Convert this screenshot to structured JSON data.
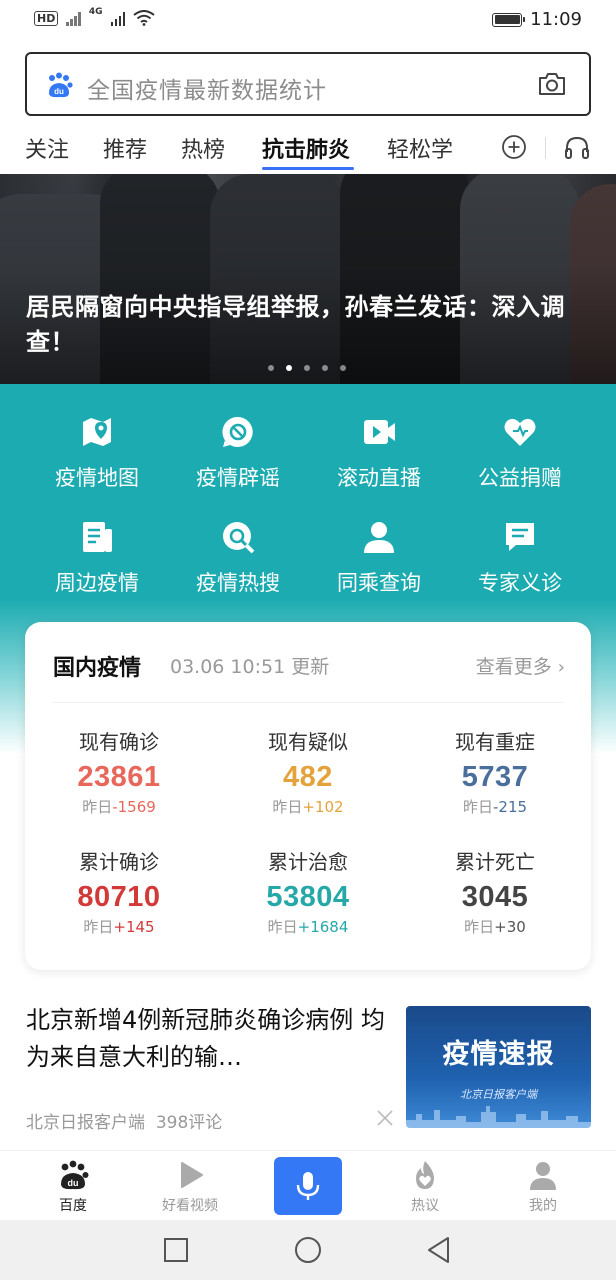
{
  "status_bar": {
    "left_badge": "HD",
    "network_label": "4G",
    "time": "11:09"
  },
  "search": {
    "placeholder": "全国疫情最新数据统计",
    "logo_icon": "baidu-paw-icon",
    "camera_icon": "camera-icon"
  },
  "tabs": [
    {
      "label": "关注",
      "active": false
    },
    {
      "label": "推荐",
      "active": false
    },
    {
      "label": "热榜",
      "active": false
    },
    {
      "label": "抗击肺炎",
      "active": true
    },
    {
      "label": "轻松学",
      "active": false
    }
  ],
  "banner": {
    "title": "居民隔窗向中央指导组举报，孙春兰发话：深入调查！",
    "dot_count": 5,
    "active_dot": 2
  },
  "feature_grid": [
    {
      "label": "疫情地图",
      "icon": "map-pin-icon"
    },
    {
      "label": "疫情辟谣",
      "icon": "block-icon"
    },
    {
      "label": "滚动直播",
      "icon": "video-icon"
    },
    {
      "label": "公益捐赠",
      "icon": "heart-icon"
    },
    {
      "label": "周边疫情",
      "icon": "document-icon"
    },
    {
      "label": "疫情热搜",
      "icon": "search-icon"
    },
    {
      "label": "同乘查询",
      "icon": "person-icon"
    },
    {
      "label": "专家义诊",
      "icon": "chat-icon"
    }
  ],
  "stats_card": {
    "title": "国内疫情",
    "updated": "03.06 10:51 更新",
    "more": "查看更多",
    "delta_prefix": "昨日",
    "stats": [
      {
        "label": "现有确诊",
        "value": "23861",
        "delta": "-1569",
        "color": "#e8665a",
        "delta_color": "#e8665a"
      },
      {
        "label": "现有疑似",
        "value": "482",
        "delta": "+102",
        "color": "#e3a33a",
        "delta_color": "#e3a33a"
      },
      {
        "label": "现有重症",
        "value": "5737",
        "delta": "-215",
        "color": "#4a6f9c",
        "delta_color": "#4a6f9c"
      },
      {
        "label": "累计确诊",
        "value": "80710",
        "delta": "+145",
        "color": "#d23a3a",
        "delta_color": "#d23a3a"
      },
      {
        "label": "累计治愈",
        "value": "53804",
        "delta": "+1684",
        "color": "#27a8a8",
        "delta_color": "#27a8a8"
      },
      {
        "label": "累计死亡",
        "value": "3045",
        "delta": "+30",
        "color": "#444444",
        "delta_color": "#555555"
      }
    ]
  },
  "news": {
    "title": "北京新增4例新冠肺炎确诊病例 均为来自意大利的输…",
    "source": "北京日报客户端",
    "comments": "398评论",
    "thumb_title": "疫情速报",
    "thumb_brand": "北京日报客户端"
  },
  "bottom_nav": [
    {
      "label": "百度",
      "icon": "baidu-paw-icon",
      "active": true
    },
    {
      "label": "好看视频",
      "icon": "play-icon",
      "active": false
    },
    {
      "label": "热议",
      "icon": "flame-icon",
      "active": false
    },
    {
      "label": "我的",
      "icon": "user-icon",
      "active": false
    }
  ],
  "colors": {
    "accent": "#3a6ff7",
    "teal": "#1cabb0",
    "mic": "#3478f6"
  }
}
